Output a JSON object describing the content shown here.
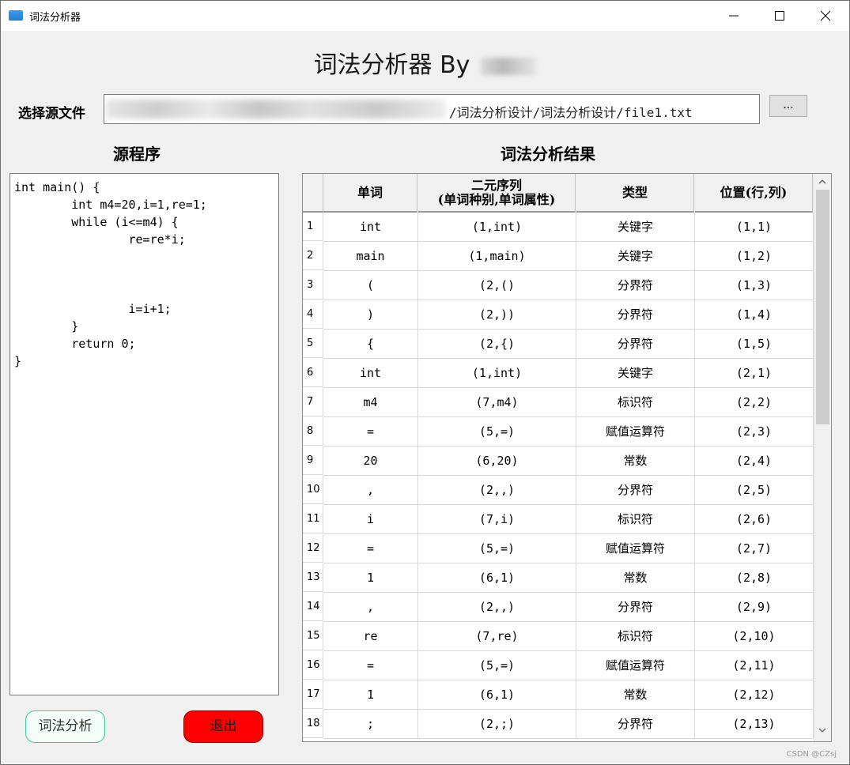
{
  "window": {
    "title": "词法分析器",
    "controls": {
      "minimize": "minimize-icon",
      "maximize": "maximize-icon",
      "close": "close-icon"
    }
  },
  "header": {
    "title": "词法分析器  By"
  },
  "file": {
    "label": "选择源文件",
    "path_visible": "/词法分析设计/词法分析设计/file1.txt",
    "browse_label": "..."
  },
  "sections": {
    "source": "源程序",
    "result": "词法分析结果"
  },
  "source_code": "int main() {\n        int m4=20,i=1,re=1;\n        while (i<=m4) {\n                re=re*i;\n\n\n\n                i=i+1;\n        }\n        return 0;\n}",
  "table": {
    "headers": {
      "word": "单词",
      "tuple_line1": "二元序列",
      "tuple_line2": "(单词种别,单词属性)",
      "type": "类型",
      "position": "位置(行,列)"
    },
    "rows": [
      {
        "n": "1",
        "word": "int",
        "tuple": "(1,int)",
        "type": "关键字",
        "pos": "(1,1)"
      },
      {
        "n": "2",
        "word": "main",
        "tuple": "(1,main)",
        "type": "关键字",
        "pos": "(1,2)"
      },
      {
        "n": "3",
        "word": "(",
        "tuple": "(2,()",
        "type": "分界符",
        "pos": "(1,3)"
      },
      {
        "n": "4",
        "word": ")",
        "tuple": "(2,))",
        "type": "分界符",
        "pos": "(1,4)"
      },
      {
        "n": "5",
        "word": "{",
        "tuple": "(2,{)",
        "type": "分界符",
        "pos": "(1,5)"
      },
      {
        "n": "6",
        "word": "int",
        "tuple": "(1,int)",
        "type": "关键字",
        "pos": "(2,1)"
      },
      {
        "n": "7",
        "word": "m4",
        "tuple": "(7,m4)",
        "type": "标识符",
        "pos": "(2,2)"
      },
      {
        "n": "8",
        "word": "=",
        "tuple": "(5,=)",
        "type": "赋值运算符",
        "pos": "(2,3)"
      },
      {
        "n": "9",
        "word": "20",
        "tuple": "(6,20)",
        "type": "常数",
        "pos": "(2,4)"
      },
      {
        "n": "10",
        "word": ",",
        "tuple": "(2,,)",
        "type": "分界符",
        "pos": "(2,5)"
      },
      {
        "n": "11",
        "word": "i",
        "tuple": "(7,i)",
        "type": "标识符",
        "pos": "(2,6)"
      },
      {
        "n": "12",
        "word": "=",
        "tuple": "(5,=)",
        "type": "赋值运算符",
        "pos": "(2,7)"
      },
      {
        "n": "13",
        "word": "1",
        "tuple": "(6,1)",
        "type": "常数",
        "pos": "(2,8)"
      },
      {
        "n": "14",
        "word": ",",
        "tuple": "(2,,)",
        "type": "分界符",
        "pos": "(2,9)"
      },
      {
        "n": "15",
        "word": "re",
        "tuple": "(7,re)",
        "type": "标识符",
        "pos": "(2,10)"
      },
      {
        "n": "16",
        "word": "=",
        "tuple": "(5,=)",
        "type": "赋值运算符",
        "pos": "(2,11)"
      },
      {
        "n": "17",
        "word": "1",
        "tuple": "(6,1)",
        "type": "常数",
        "pos": "(2,12)"
      },
      {
        "n": "18",
        "word": ";",
        "tuple": "(2,;)",
        "type": "分界符",
        "pos": "(2,13)"
      }
    ]
  },
  "buttons": {
    "analyze": "词法分析",
    "exit": "退出"
  },
  "colors": {
    "exit_button": "#ff0000",
    "analyze_border": "#40c6a2",
    "window_bg": "#f0f0f0"
  },
  "watermark": "CSDN @CZsj"
}
